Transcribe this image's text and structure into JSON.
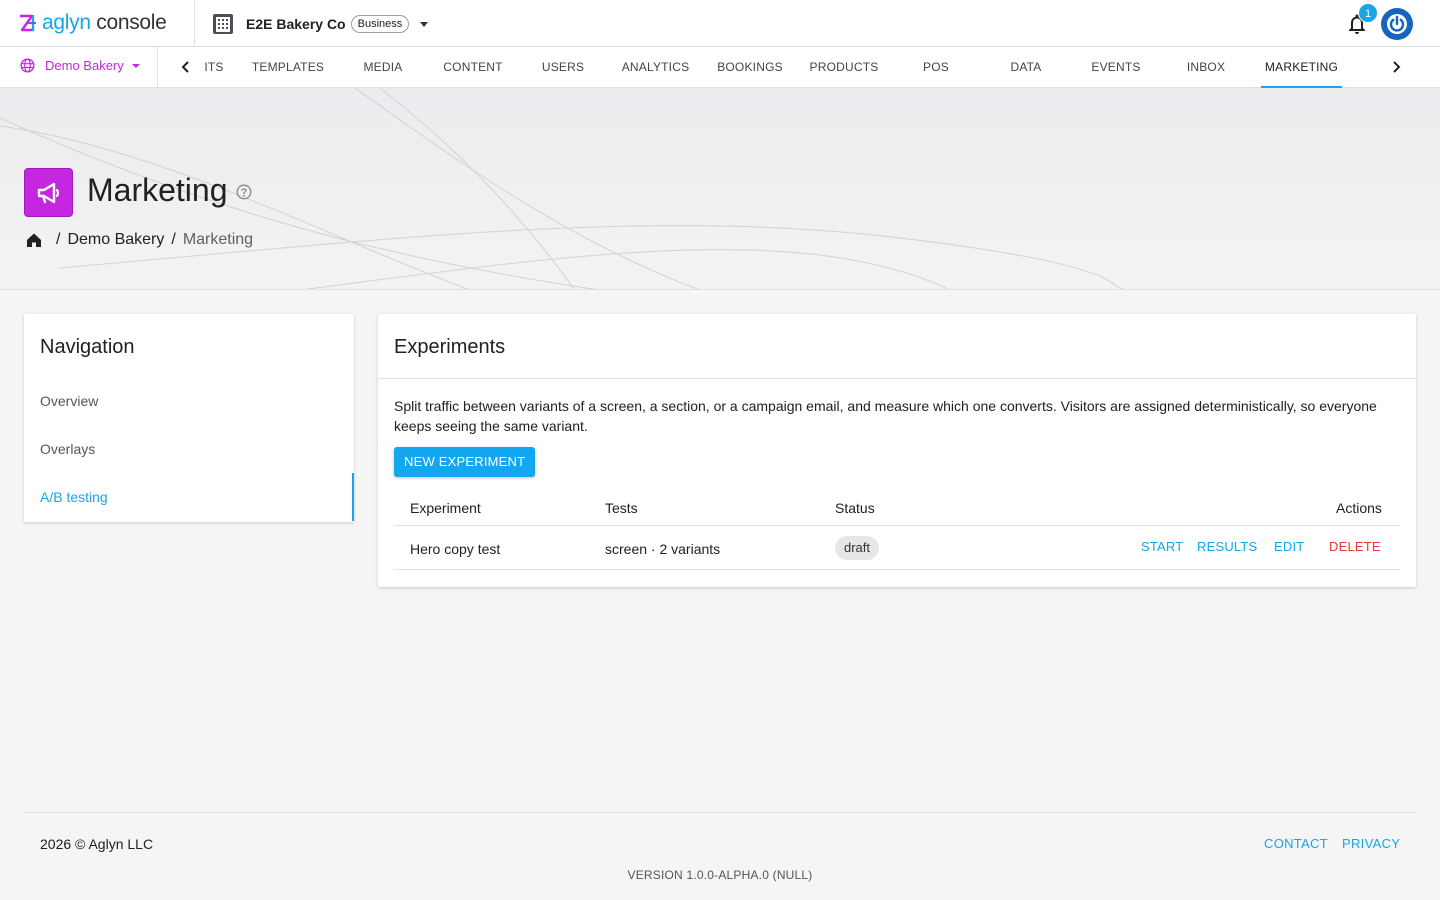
{
  "app": {
    "logo_brand": "aglyn",
    "logo_product": " console",
    "org_name": "E2E Bakery Co",
    "org_plan": "Business",
    "notification_count": "1"
  },
  "site_selector": {
    "label": "Demo Bakery"
  },
  "tabs": [
    "ITS",
    "TEMPLATES",
    "MEDIA",
    "CONTENT",
    "USERS",
    "ANALYTICS",
    "BOOKINGS",
    "PRODUCTS",
    "POS",
    "DATA",
    "EVENTS",
    "INBOX",
    "MARKETING"
  ],
  "active_tab": "MARKETING",
  "hero": {
    "title": "Marketing",
    "breadcrumb": [
      "Demo Bakery",
      "Marketing"
    ]
  },
  "navigation": {
    "title": "Navigation",
    "items": [
      "Overview",
      "Overlays",
      "A/B testing"
    ],
    "active": "A/B testing"
  },
  "experiments": {
    "title": "Experiments",
    "description": "Split traffic between variants of a screen, a section, or a campaign email, and measure which one converts. Visitors are assigned deterministically, so everyone keeps seeing the same variant.",
    "new_button": "NEW EXPERIMENT",
    "columns": [
      "Experiment",
      "Tests",
      "Status",
      "Actions"
    ],
    "rows": [
      {
        "experiment": "Hero copy test",
        "tests": "screen · 2 variants",
        "status": "draft",
        "actions": [
          "START",
          "RESULTS",
          "EDIT",
          "DELETE"
        ]
      }
    ]
  },
  "footer": {
    "copyright": "2026 © Aglyn LLC",
    "links": [
      "CONTACT",
      "PRIVACY"
    ],
    "version": "VERSION 1.0.0-ALPHA.0 (NULL)"
  },
  "colors": {
    "accent": "#1aa6e6",
    "brand_magenta": "#c526e0",
    "danger": "#e53935",
    "avatar": "#1565c0"
  },
  "icons": [
    "aglyn-logo-icon",
    "building-icon",
    "chevron-down-icon",
    "bell-icon",
    "power-icon",
    "globe-icon",
    "chevron-left-icon",
    "chevron-right-icon",
    "megaphone-icon",
    "help-circle-icon",
    "home-icon"
  ]
}
